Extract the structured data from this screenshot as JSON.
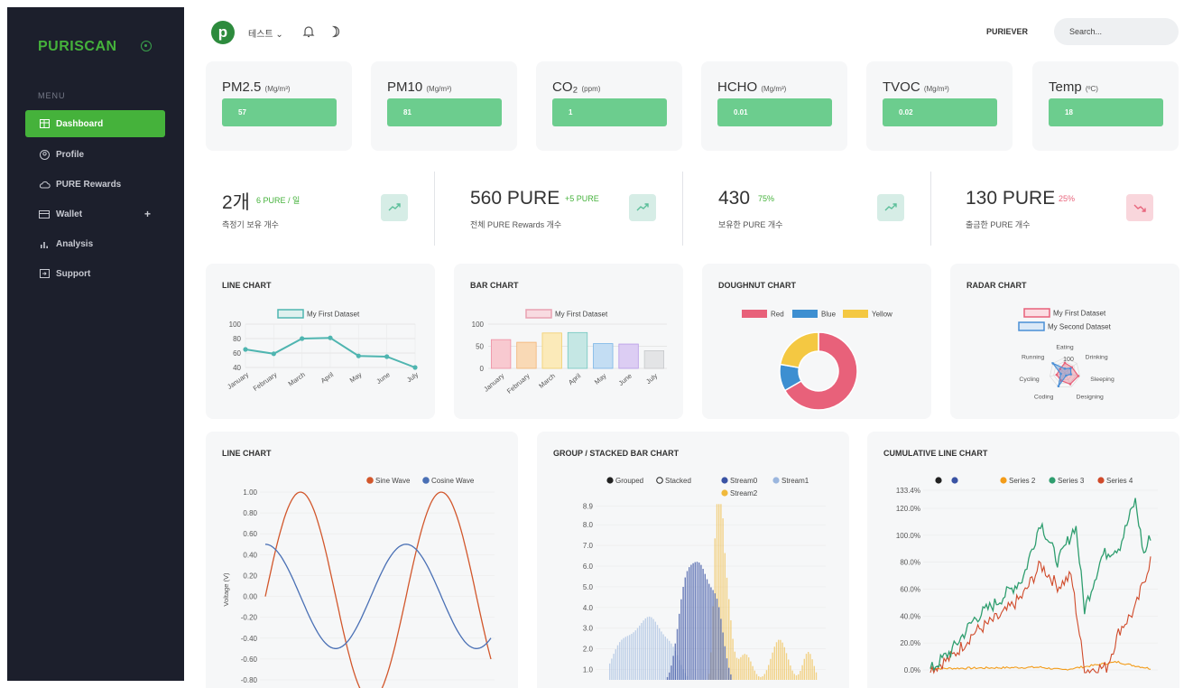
{
  "sidebar": {
    "brand": "PURISCAN",
    "menu_heading": "MENU",
    "items": [
      {
        "label": "Dashboard"
      },
      {
        "label": "Profile"
      },
      {
        "label": "PURE Rewards"
      },
      {
        "label": "Wallet"
      },
      {
        "label": "Analysis"
      },
      {
        "label": "Support"
      }
    ]
  },
  "topbar": {
    "logo_letter": "p",
    "selector": "테스트 ⌄",
    "user": "PURIEVER",
    "search_placeholder": "Search..."
  },
  "metrics": [
    {
      "name": "PM2.5",
      "unit": "(Mg/m³)",
      "value": "57"
    },
    {
      "name": "PM10",
      "unit": "(Mg/m³)",
      "value": "81"
    },
    {
      "name": "CO₂",
      "unit": "(ppm)",
      "value": "1"
    },
    {
      "name": "HCHO",
      "unit": "(Mg/m³)",
      "value": "0.01"
    },
    {
      "name": "TVOC",
      "unit": "(Mg/m³)",
      "value": "0.02"
    },
    {
      "name": "Temp",
      "unit": "(ºC)",
      "value": "18"
    }
  ],
  "stats": [
    {
      "big": "2개",
      "small": "6 PURE / 일",
      "sub": "측정기 보유 개수",
      "trend": "up"
    },
    {
      "big": "560 PURE",
      "small": "+5 PURE",
      "sub": "전체 PURE Rewards 개수",
      "trend": "up"
    },
    {
      "big": "430",
      "small": "75%",
      "sub": "보유한 PURE 개수",
      "trend": "up"
    },
    {
      "big": "130 PURE",
      "small": "25%",
      "sub": "출금한 PURE 개수",
      "trend": "down"
    }
  ],
  "colors": {
    "brand_green": "#45b23b",
    "metric_green": "#6ccd8e",
    "sidebar_bg": "#1c1f2c",
    "up": "#7ec9a6",
    "down": "#e8657c"
  },
  "charts": {
    "line1": {
      "title": "LINE CHART",
      "legend": "My First Dataset"
    },
    "bar1": {
      "title": "BAR CHART",
      "legend": "My First Dataset"
    },
    "doughnut": {
      "title": "DOUGHNUT CHART",
      "legend": [
        "Red",
        "Blue",
        "Yellow"
      ]
    },
    "radar": {
      "title": "RADAR CHART",
      "legend": [
        "My First Dataset",
        "My Second Dataset"
      ],
      "tick": "100"
    },
    "line2": {
      "title": "LINE CHART",
      "legend": [
        "Sine Wave",
        "Cosine Wave"
      ],
      "ylabel": "Voltage (V)"
    },
    "stacked": {
      "title": "GROUP / STACKED BAR CHART",
      "legend": [
        "Grouped",
        "Stacked",
        "Stream0",
        "Stream1",
        "Stream2"
      ]
    },
    "cumulative": {
      "title": "CUMULATIVE LINE CHART",
      "legend": [
        "Series 2",
        "Series 3",
        "Series 4"
      ]
    }
  },
  "chart_data": [
    {
      "type": "line",
      "title": "LINE CHART",
      "categories": [
        "January",
        "February",
        "March",
        "April",
        "May",
        "June",
        "July"
      ],
      "series": [
        {
          "name": "My First Dataset",
          "values": [
            65,
            59,
            80,
            81,
            56,
            55,
            40
          ]
        }
      ],
      "ylim": [
        40,
        100
      ],
      "yticks": [
        "100",
        "80",
        "60",
        "40"
      ],
      "grid": true,
      "legend": "top"
    },
    {
      "type": "bar",
      "title": "BAR CHART",
      "categories": [
        "January",
        "February",
        "March",
        "April",
        "May",
        "June",
        "July"
      ],
      "series": [
        {
          "name": "My First Dataset",
          "values": [
            65,
            59,
            80,
            81,
            56,
            55,
            40
          ]
        }
      ],
      "ylim": [
        0,
        100
      ],
      "yticks": [
        "100",
        "50",
        "0"
      ],
      "grid": true,
      "legend": "top",
      "colors": [
        "#f8c9d0",
        "#f9d9b5",
        "#fbeab9",
        "#c5e7e4",
        "#c3ddf3",
        "#dccdf3",
        "#e3e4e6"
      ]
    },
    {
      "type": "pie",
      "title": "DOUGHNUT CHART",
      "categories": [
        "Red",
        "Blue",
        "Yellow"
      ],
      "values": [
        300,
        50,
        100
      ],
      "colors": [
        "#e8617a",
        "#3d8fd1",
        "#f4c842"
      ],
      "legend": "top"
    },
    {
      "type": "line",
      "title": "RADAR CHART",
      "categories": [
        "Eating",
        "Drinking",
        "Sleeping",
        "Designing",
        "Coding",
        "Cycling",
        "Running"
      ],
      "series": [
        {
          "name": "My First Dataset",
          "values": [
            65,
            59,
            90,
            81,
            56,
            55,
            40
          ]
        },
        {
          "name": "My Second Dataset",
          "values": [
            28,
            48,
            40,
            19,
            96,
            27,
            100
          ]
        }
      ],
      "ylim": [
        0,
        100
      ],
      "legend": "top"
    },
    {
      "type": "line",
      "title": "LINE CHART",
      "ylabel": "Voltage (V)",
      "yticks": [
        "1.00",
        "0.80",
        "0.60",
        "0.40",
        "0.20",
        "0.00",
        "-0.20",
        "-0.40",
        "-0.60",
        "-0.80"
      ],
      "series": [
        {
          "name": "Sine Wave",
          "color": "#d2572c",
          "amplitude": 1.0,
          "phase": 0
        },
        {
          "name": "Cosine Wave",
          "color": "#4a70b5",
          "amplitude": 0.5,
          "phase": 90
        }
      ],
      "ylim": [
        -0.9,
        1.1
      ],
      "grid": true,
      "legend": "top-right"
    },
    {
      "type": "bar",
      "title": "GROUP / STACKED BAR CHART",
      "yticks": [
        "8.9",
        "8.0",
        "7.0",
        "6.0",
        "5.0",
        "4.0",
        "3.0",
        "2.0",
        "1.0"
      ],
      "series": [
        {
          "name": "Stream0",
          "color": "#3a53a4",
          "peak": 5.5
        },
        {
          "name": "Stream1",
          "color": "#9bb6de",
          "peak": 2.1
        },
        {
          "name": "Stream2",
          "color": "#f0b93c",
          "peak": 8.9
        }
      ],
      "ylim": [
        0.5,
        9.2
      ],
      "grid": true,
      "legend": "top"
    },
    {
      "type": "line",
      "title": "CUMULATIVE LINE CHART",
      "yticks": [
        "133.4%",
        "120.0%",
        "100.0%",
        "80.0%",
        "60.0%",
        "40.0%",
        "20.0%",
        "0.0%"
      ],
      "series": [
        {
          "name": "Series 2",
          "color": "#f39c19"
        },
        {
          "name": "Series 3",
          "color": "#2f9e6f"
        },
        {
          "name": "Series 4",
          "color": "#d04a2a"
        }
      ],
      "ylim": [
        -3,
        136
      ],
      "grid": true,
      "legend": "top"
    }
  ]
}
